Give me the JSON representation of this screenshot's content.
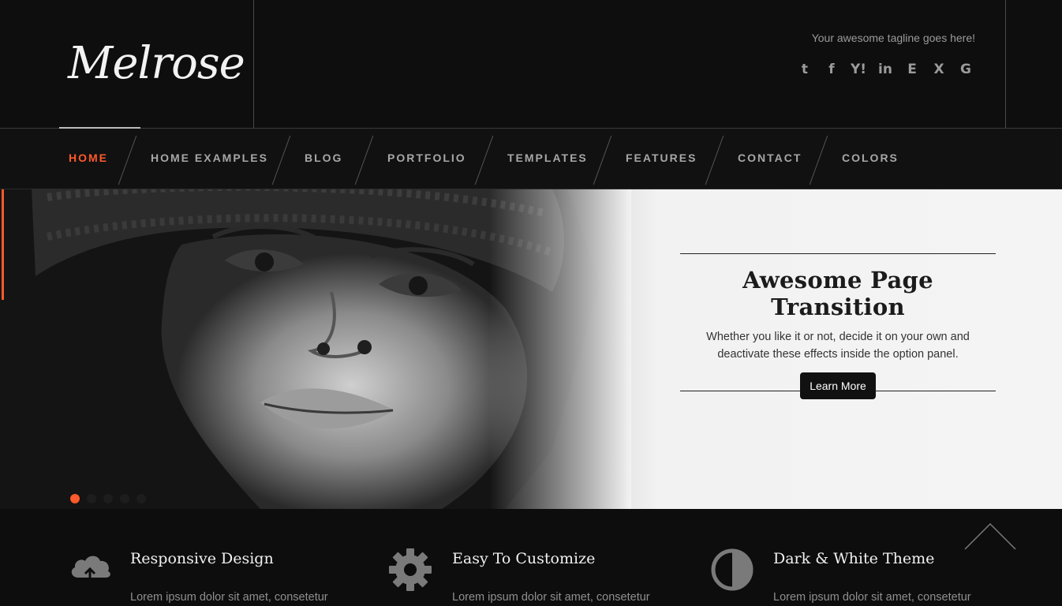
{
  "header": {
    "logo_text": "Melrose",
    "tagline": "Your awesome tagline goes here!",
    "social_icons": [
      {
        "name": "twitter-icon",
        "glyph": "t"
      },
      {
        "name": "facebook-icon",
        "glyph": "f"
      },
      {
        "name": "yahoo-icon",
        "glyph": "Y!"
      },
      {
        "name": "linkedin-icon",
        "glyph": "in"
      },
      {
        "name": "etsy-icon",
        "glyph": "E"
      },
      {
        "name": "xing-icon",
        "glyph": "X"
      },
      {
        "name": "delicious-icon",
        "glyph": "G"
      }
    ]
  },
  "nav": {
    "items": [
      {
        "label": "HOME",
        "active": true
      },
      {
        "label": "HOME EXAMPLES",
        "active": false
      },
      {
        "label": "BLOG",
        "active": false
      },
      {
        "label": "PORTFOLIO",
        "active": false
      },
      {
        "label": "TEMPLATES",
        "active": false
      },
      {
        "label": "FEATURES",
        "active": false
      },
      {
        "label": "CONTACT",
        "active": false
      },
      {
        "label": "COLORS",
        "active": false
      }
    ]
  },
  "slider": {
    "title": "Awesome Page Transition",
    "text": "Whether you like it or not, decide it on your own and deactivate these effects inside the option panel.",
    "button_label": "Learn More",
    "dot_count": 5,
    "active_dot": 0
  },
  "features": [
    {
      "icon": "cloud-upload-icon",
      "title": "Responsive Design",
      "text": "Lorem ipsum dolor sit amet, consetetur"
    },
    {
      "icon": "gear-icon",
      "title": "Easy To Customize",
      "text": "Lorem ipsum dolor sit amet, consetetur"
    },
    {
      "icon": "half-circle-contrast-icon",
      "title": "Dark & White Theme",
      "text": "Lorem ipsum dolor sit amet, consetetur"
    }
  ],
  "colors": {
    "accent": "#ff5a2b",
    "background": "#0e0e0e"
  }
}
